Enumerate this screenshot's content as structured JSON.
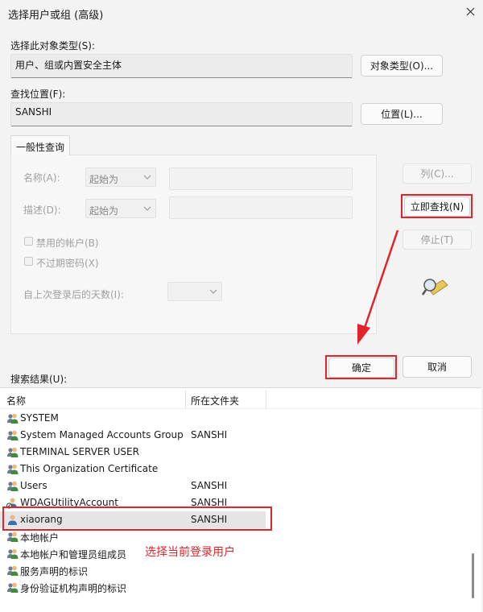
{
  "window": {
    "title": "选择用户或组 (高级)"
  },
  "object_type": {
    "label": "选择此对象类型(S):",
    "value": "用户、组或内置安全主体",
    "button": "对象类型(O)..."
  },
  "location": {
    "label": "查找位置(F):",
    "value": "SANSHI",
    "button": "位置(L)..."
  },
  "query": {
    "tab": "一般性查询",
    "name_label": "名称(A):",
    "name_mode": "起始为",
    "desc_label": "描述(D):",
    "desc_mode": "起始为",
    "disabled_accounts": "禁用的帐户(B)",
    "no_expire_pwd": "不过期密码(X)",
    "days_label": "自上次登录后的天数(I):"
  },
  "side_buttons": {
    "columns": "列(C)...",
    "find_now": "立即查找(N)",
    "stop": "停止(T)"
  },
  "actions": {
    "ok": "确定",
    "cancel": "取消"
  },
  "results": {
    "label": "搜索结果(U):",
    "columns": [
      "名称",
      "所在文件夹"
    ],
    "rows": [
      {
        "name": "SYSTEM",
        "folder": "",
        "icon": "group-icon"
      },
      {
        "name": "System Managed Accounts Group",
        "folder": "SANSHI",
        "icon": "group-icon"
      },
      {
        "name": "TERMINAL SERVER USER",
        "folder": "",
        "icon": "group-icon"
      },
      {
        "name": "This Organization Certificate",
        "folder": "",
        "icon": "group-icon"
      },
      {
        "name": "Users",
        "folder": "SANSHI",
        "icon": "group-icon"
      },
      {
        "name": "WDAGUtilityAccount",
        "folder": "SANSHI",
        "icon": "user-disabled-icon"
      },
      {
        "name": "xiaorang",
        "folder": "SANSHI",
        "icon": "user-icon"
      },
      {
        "name": "本地帐户",
        "folder": "",
        "icon": "group-icon"
      },
      {
        "name": "本地帐户和管理员组成员",
        "folder": "",
        "icon": "group-icon"
      },
      {
        "name": "服务声明的标识",
        "folder": "",
        "icon": "group-icon"
      },
      {
        "name": "身份验证机构声明的标识",
        "folder": "",
        "icon": "group-icon"
      }
    ]
  },
  "annotation": {
    "text": "选择当前登录用户",
    "color": "#e0242b"
  }
}
